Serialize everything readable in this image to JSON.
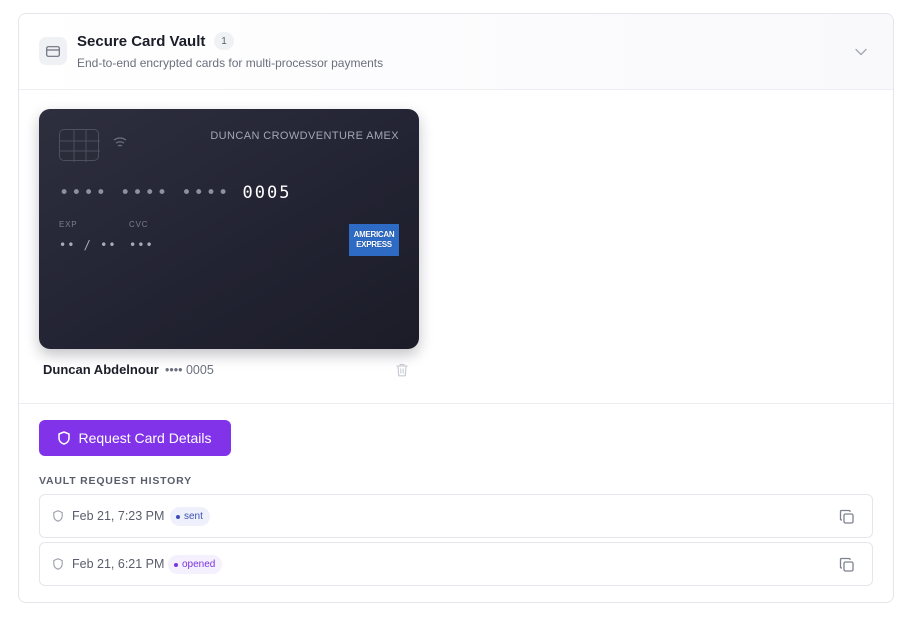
{
  "header": {
    "title": "Secure Card Vault",
    "count": "1",
    "subtitle": "End-to-end encrypted cards for multi-processor payments",
    "icon": "credit-card-icon",
    "collapse_icon": "chevron-down-icon"
  },
  "card": {
    "holder_brand": "DUNCAN CROWDVENTURE AMEX",
    "number_masked": "•••• •••• •••• ",
    "last4": "0005",
    "exp_label": "EXP",
    "exp_value": "•• / ••",
    "cvc_label": "CVC",
    "cvc_value": "•••",
    "network_logo_lines": [
      "AMERICAN",
      "EXPRESS"
    ],
    "colors": {
      "background": "#242535",
      "network": "#2e6bc4"
    }
  },
  "card_meta": {
    "name": "Duncan Abdelnour",
    "number": "•••• 0005",
    "delete_icon": "trash-icon"
  },
  "actions": {
    "request_label": "Request Card Details",
    "request_icon": "shield-icon",
    "accent": "#8133ea"
  },
  "history": {
    "title": "VAULT REQUEST HISTORY",
    "rows": [
      {
        "time": "Feb 21, 7:23 PM",
        "status": "sent",
        "status_color": "#3d4fb5"
      },
      {
        "time": "Feb 21, 6:21 PM",
        "status": "opened",
        "status_color": "#7a35dc"
      }
    ],
    "copy_icon": "copy-icon",
    "row_icon": "shield-icon"
  }
}
